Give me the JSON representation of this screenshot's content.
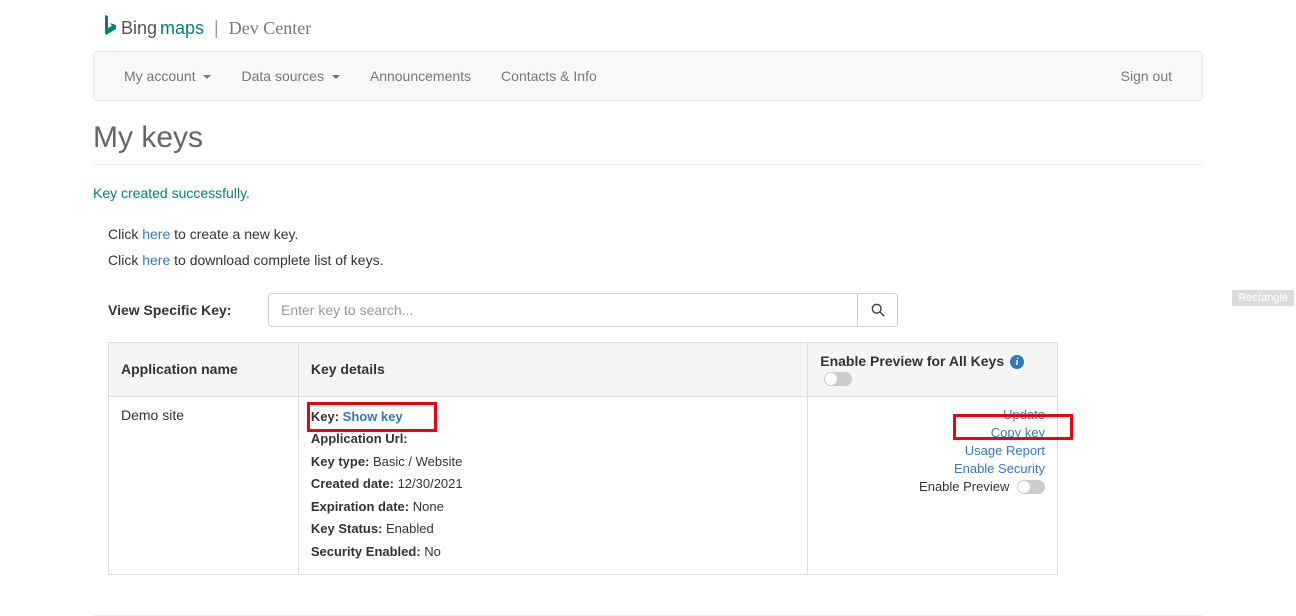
{
  "header": {
    "bing_text": "Bing",
    "maps_text": "maps",
    "divider": "|",
    "dev_center": "Dev Center"
  },
  "nav": {
    "items": [
      {
        "label": "My account",
        "dropdown": true
      },
      {
        "label": "Data sources",
        "dropdown": true
      },
      {
        "label": "Announcements",
        "dropdown": false
      },
      {
        "label": "Contacts & Info",
        "dropdown": false
      }
    ],
    "signout": "Sign out"
  },
  "page": {
    "title": "My keys",
    "success_msg": "Key created successfully.",
    "create_prefix": "Click ",
    "create_link": "here",
    "create_suffix": " to create a new key.",
    "download_prefix": "Click ",
    "download_link": "here",
    "download_suffix": " to download complete list of keys."
  },
  "search": {
    "label": "View Specific Key:",
    "placeholder": "Enter key to search..."
  },
  "table": {
    "col_appname": "Application name",
    "col_details": "Key details",
    "col_preview": "Enable Preview for All Keys",
    "row": {
      "app_name": "Demo site",
      "key_label": "Key: ",
      "show_key": "Show key",
      "appurl_label": "Application Url:",
      "appurl_value": "",
      "keytype_label": "Key type: ",
      "keytype_value": "Basic / Website",
      "created_label": "Created date: ",
      "created_value": "12/30/2021",
      "expiration_label": "Expiration date: ",
      "expiration_value": "None",
      "status_label": "Key Status: ",
      "status_value": "Enabled",
      "security_label": "Security Enabled: ",
      "security_value": "No"
    },
    "actions": {
      "update": "Update",
      "copy": "Copy key",
      "usage": "Usage Report",
      "enable_sec": "Enable Security",
      "enable_prev": "Enable Preview"
    }
  },
  "watermark": "Rectangle"
}
